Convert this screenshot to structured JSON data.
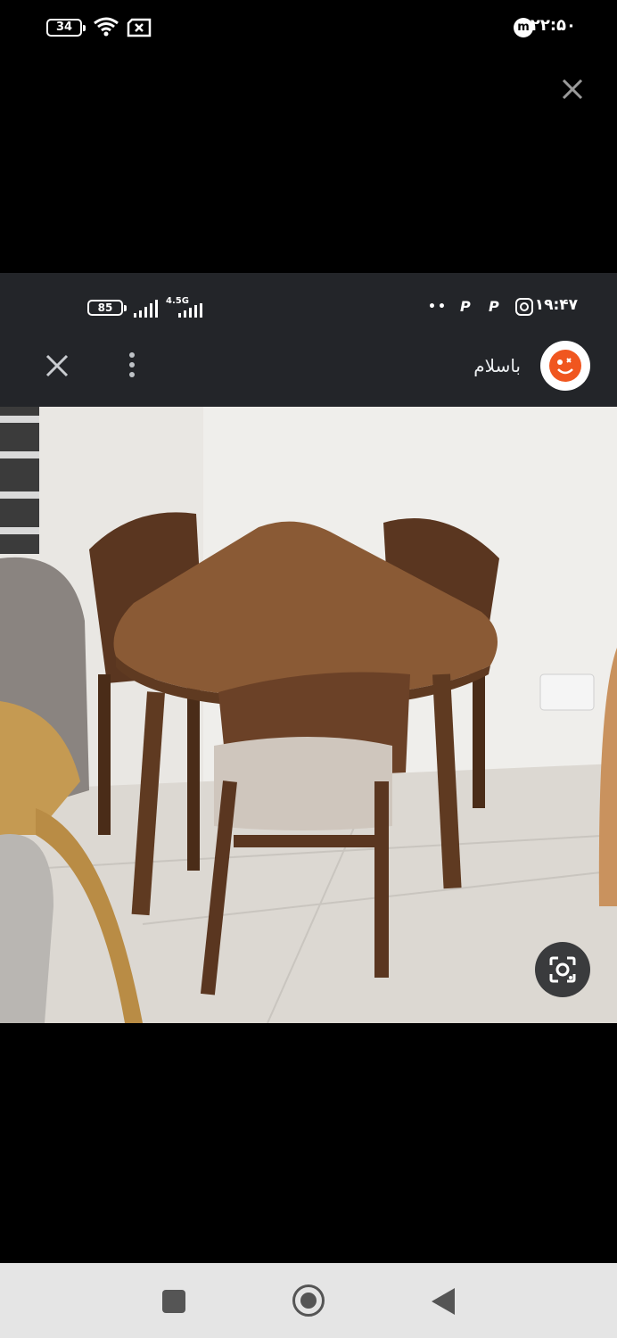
{
  "outer_status": {
    "battery_level": "34",
    "time": "۲۲:۵۰",
    "icons": [
      "battery-icon",
      "wifi-icon",
      "sim-error-icon",
      "m-app-icon"
    ]
  },
  "overlay": {
    "close_icon": "close-icon"
  },
  "inner_status": {
    "battery_level": "85",
    "network_type": "4.5G",
    "time": "۱۹:۴۷",
    "icons": [
      "battery-icon",
      "signal-icon",
      "signal-icon",
      "p-app-icon",
      "p-app-icon",
      "instagram-icon",
      "more-notifications-icon"
    ]
  },
  "inner_header": {
    "title": "باسلام",
    "close_icon": "close-icon",
    "more_icon": "more-vert-icon",
    "avatar_icon": "avatar-face-icon"
  },
  "photo": {
    "subject": "image",
    "lens_icon": "lens-search-icon"
  },
  "navbar": {
    "recents_icon": "recents-square-icon",
    "home_icon": "home-circle-icon",
    "back_icon": "back-triangle-icon"
  },
  "colors": {
    "background": "#000000",
    "inner_bar": "#232529",
    "avatar_accent": "#f0561f",
    "navbar": "#e5e5e5",
    "table_wood": "#8a5a35",
    "chair_wood": "#5a3620",
    "wall": "#e9e7e3",
    "floor": "#dcd8d2"
  }
}
